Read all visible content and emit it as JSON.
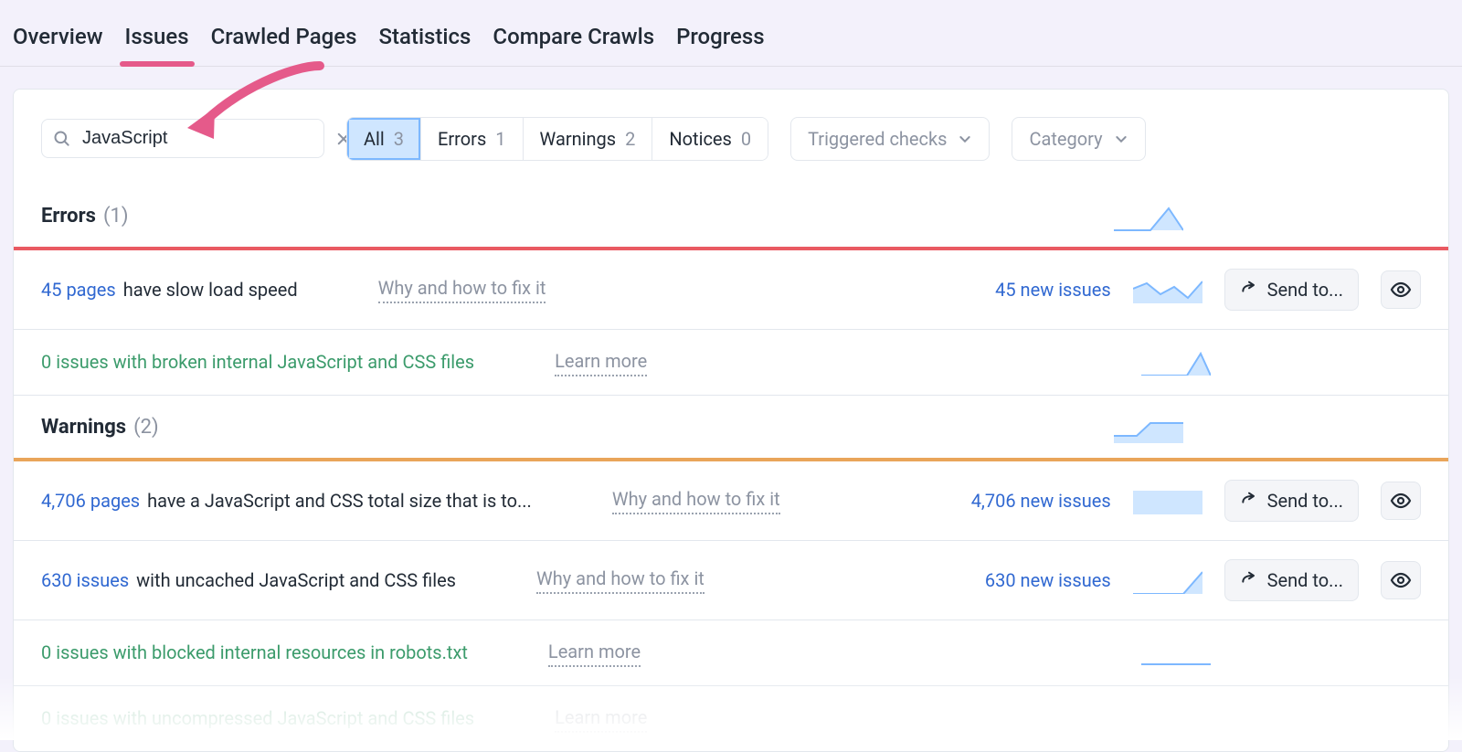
{
  "tabs": {
    "overview": "Overview",
    "issues": "Issues",
    "crawled_pages": "Crawled Pages",
    "statistics": "Statistics",
    "compare_crawls": "Compare Crawls",
    "progress": "Progress",
    "active": "issues"
  },
  "search": {
    "value": "JavaScript"
  },
  "filters": {
    "all": {
      "label": "All",
      "count": "3"
    },
    "errors": {
      "label": "Errors",
      "count": "1"
    },
    "warnings": {
      "label": "Warnings",
      "count": "2"
    },
    "notices": {
      "label": "Notices",
      "count": "0"
    }
  },
  "dropdowns": {
    "triggered_checks": "Triggered checks",
    "category": "Category"
  },
  "sections": {
    "errors": {
      "title": "Errors",
      "count": "(1)"
    },
    "warnings": {
      "title": "Warnings",
      "count": "(2)"
    }
  },
  "rows": {
    "r1": {
      "count_text": "45 pages",
      "rest": "have slow load speed",
      "helper": "Why and how to fix it",
      "new_issues": "45 new issues",
      "send": "Send to..."
    },
    "r2": {
      "text": "0 issues with broken internal JavaScript and CSS files",
      "helper": "Learn more"
    },
    "r3": {
      "count_text": "4,706 pages",
      "rest": "have a JavaScript and CSS total size that is to...",
      "helper": "Why and how to fix it",
      "new_issues": "4,706 new issues",
      "send": "Send to..."
    },
    "r4": {
      "count_text": "630 issues",
      "rest": "with uncached JavaScript and CSS files",
      "helper": "Why and how to fix it",
      "new_issues": "630 new issues",
      "send": "Send to..."
    },
    "r5": {
      "text": "0 issues with blocked internal resources in robots.txt",
      "helper": "Learn more"
    },
    "r6": {
      "text": "0 issues with uncompressed JavaScript and CSS files",
      "helper": "Learn more"
    }
  }
}
